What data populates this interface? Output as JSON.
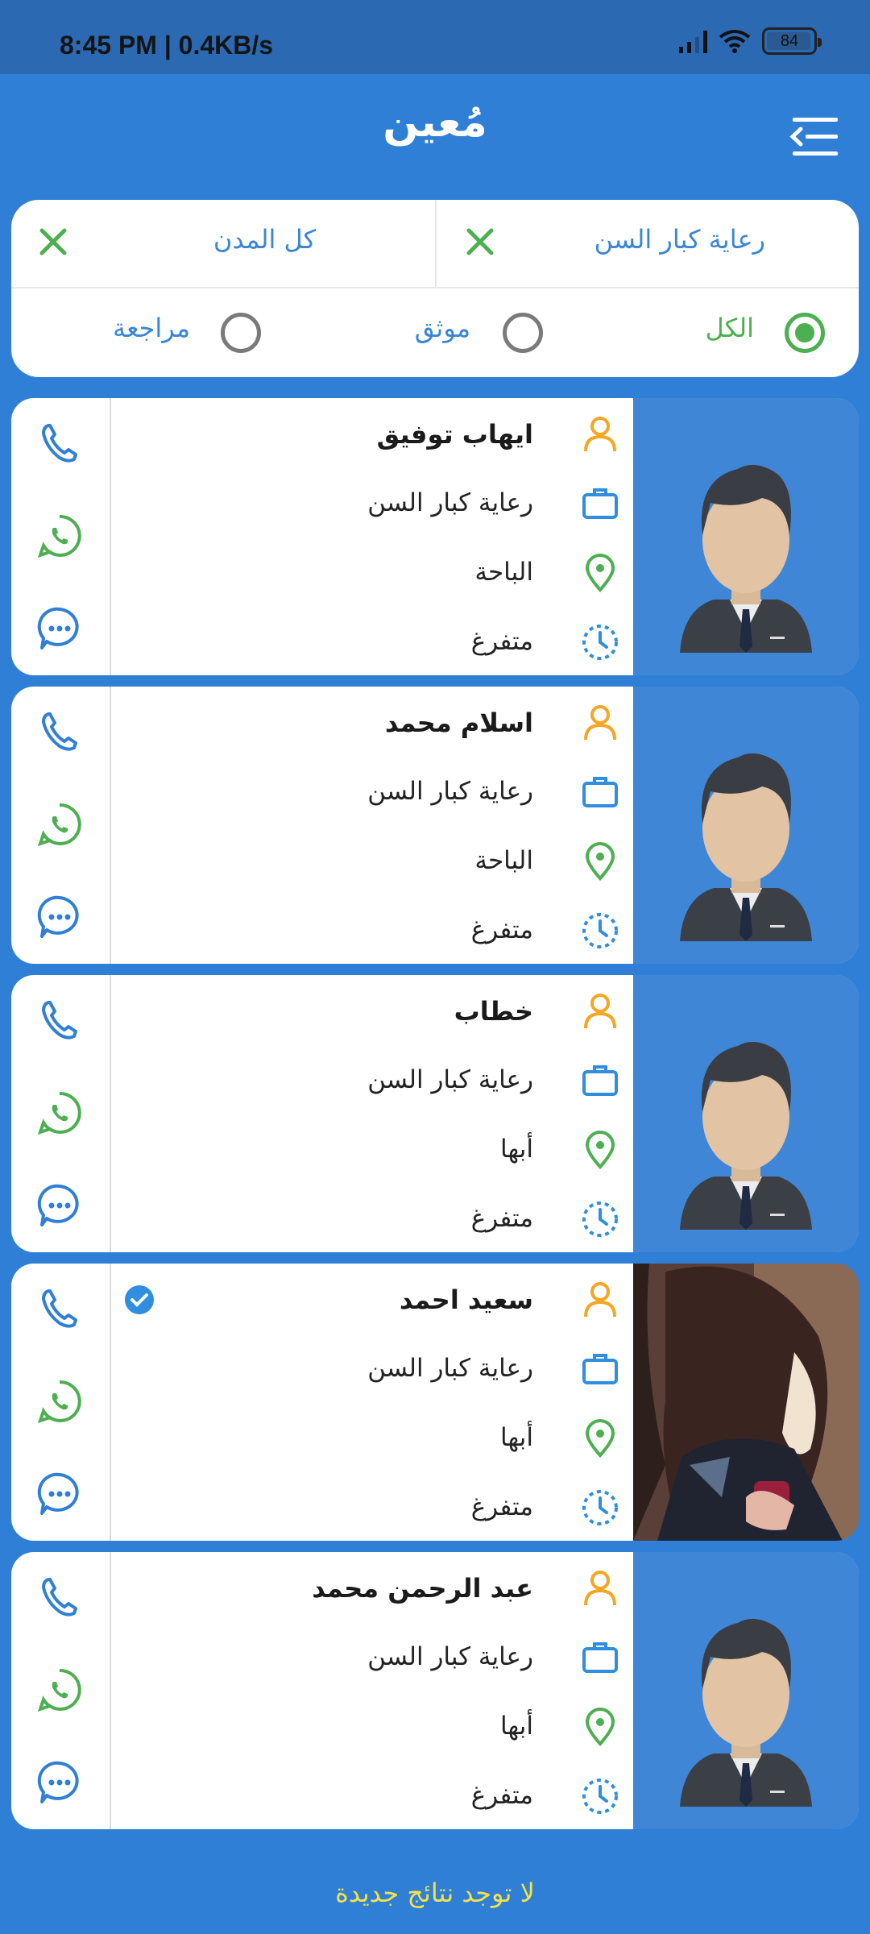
{
  "status_bar": {
    "time": "8:45 PM | 0.4KB/s",
    "battery": "84"
  },
  "app": {
    "title": "مُعين"
  },
  "filters": {
    "service": "رعاية كبار السن",
    "city": "كل المدن",
    "options": [
      "الكل",
      "موثق",
      "مراجعة"
    ],
    "selected": "الكل"
  },
  "profiles": [
    {
      "name": "ايهاب توفيق",
      "service": "رعاية كبار السن",
      "city": "الباحة",
      "availability": "متفرغ",
      "verified": false,
      "photo": "avatar-placeholder"
    },
    {
      "name": "اسلام محمد",
      "service": "رعاية كبار السن",
      "city": "الباحة",
      "availability": "متفرغ",
      "verified": false,
      "photo": "avatar-placeholder"
    },
    {
      "name": "خطاب",
      "service": "رعاية كبار السن",
      "city": "أبها",
      "availability": "متفرغ",
      "verified": false,
      "photo": "avatar-placeholder"
    },
    {
      "name": "سعيد احمد",
      "service": "رعاية كبار السن",
      "city": "أبها",
      "availability": "متفرغ",
      "verified": true,
      "photo": "user-photo"
    },
    {
      "name": "عبد الرحمن محمد",
      "service": "رعاية كبار السن",
      "city": "أبها",
      "availability": "متفرغ",
      "verified": false,
      "photo": "avatar-placeholder"
    }
  ],
  "footer": {
    "message": "لا توجد نتائج جديدة"
  },
  "colors": {
    "primary": "#2f7fd6",
    "status_bar": "#2b69b3",
    "accent_green": "#4caf50",
    "accent_orange": "#f5a623",
    "footer_text": "#f2e14a"
  }
}
